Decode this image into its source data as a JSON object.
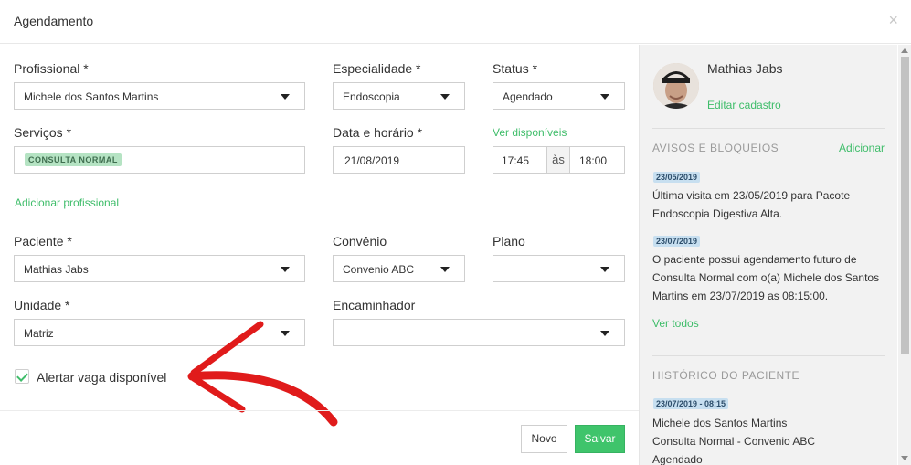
{
  "modal": {
    "title": "Agendamento",
    "close": "×"
  },
  "form": {
    "profissional": {
      "label": "Profissional *",
      "value": "Michele dos Santos Martins"
    },
    "especialidade": {
      "label": "Especialidade *",
      "value": "Endoscopia"
    },
    "status": {
      "label": "Status *",
      "value": "Agendado"
    },
    "servicos": {
      "label": "Serviços *",
      "tag": "CONSULTA NORMAL"
    },
    "data": {
      "label": "Data e horário *",
      "value": "21/08/2019"
    },
    "horario": {
      "link": "Ver disponíveis",
      "start": "17:45",
      "sep": "às",
      "end": "18:00"
    },
    "add_profissional": "Adicionar profissional",
    "paciente": {
      "label": "Paciente *",
      "value": "Mathias Jabs"
    },
    "convenio": {
      "label": "Convênio",
      "value": "Convenio ABC"
    },
    "plano": {
      "label": "Plano",
      "value": ""
    },
    "unidade": {
      "label": "Unidade *",
      "value": "Matriz"
    },
    "encaminhador": {
      "label": "Encaminhador",
      "value": ""
    },
    "alertar": {
      "label": "Alertar vaga disponível",
      "checked": true
    }
  },
  "footer": {
    "novo": "Novo",
    "salvar": "Salvar"
  },
  "sidebar": {
    "patient_name": "Mathias Jabs",
    "edit_link": "Editar cadastro",
    "avisos": {
      "title": "AVISOS E BLOQUEIOS",
      "add": "Adicionar",
      "items": [
        {
          "date": "23/05/2019",
          "text": "Última visita em 23/05/2019 para Pacote Endoscopia Digestiva Alta."
        },
        {
          "date": "23/07/2019",
          "text": "O paciente possui agendamento futuro de Consulta Normal com o(a) Michele dos Santos Martins em 23/07/2019 as 08:15:00."
        }
      ],
      "see_all": "Ver todos"
    },
    "historico": {
      "title": "HISTÓRICO DO PACIENTE",
      "items": [
        {
          "date": "23/07/2019 - 08:15",
          "line1": "Michele dos Santos Martins",
          "line2": "Consulta Normal - Convenio ABC",
          "line3": "Agendado"
        }
      ]
    }
  },
  "colors": {
    "accent": "#3fbd6a",
    "annotation": "#e01b1b"
  }
}
